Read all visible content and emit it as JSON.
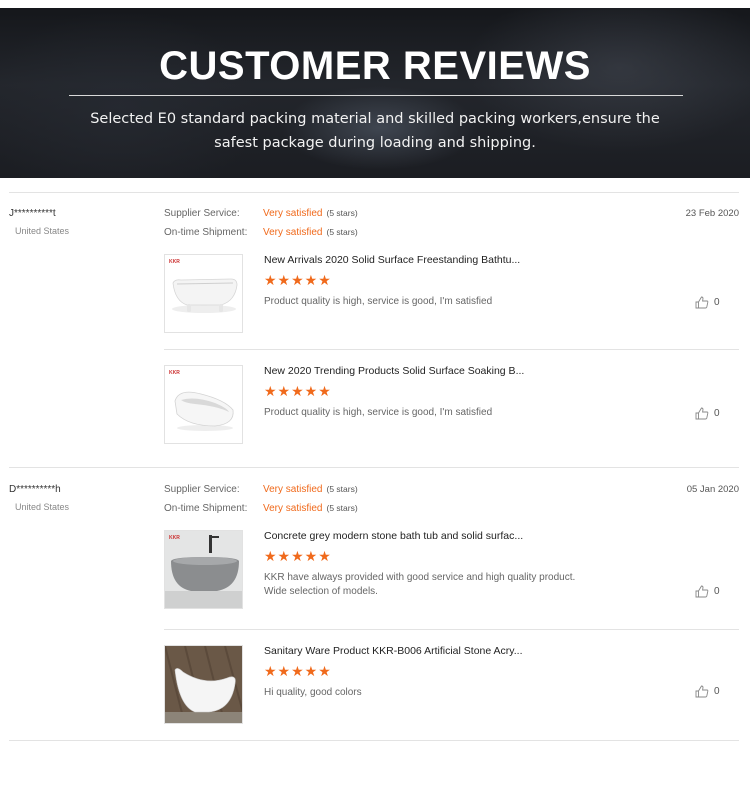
{
  "hero": {
    "title": "CUSTOMER REVIEWS",
    "subtitle": "Selected E0 standard packing material and skilled packing workers,ensure the safest package during loading and shipping."
  },
  "reviews": [
    {
      "name": "J**********t",
      "country": "United States",
      "date": "23 Feb 2020",
      "ratings": [
        {
          "label": "Supplier Service:",
          "value": "Very satisfied",
          "note": "(5 stars)"
        },
        {
          "label": "On-time Shipment:",
          "value": "Very satisfied",
          "note": "(5 stars)"
        }
      ],
      "products": [
        {
          "title": "New Arrivals 2020 Solid Surface Freestanding Bathtu...",
          "stars": "★★★★★",
          "comment": "Product quality is high, service is good, I'm satisfied",
          "likes": "0",
          "brand": "KKR"
        },
        {
          "title": "New 2020 Trending Products Solid Surface Soaking B...",
          "stars": "★★★★★",
          "comment": "Product quality is high, service is good, I'm satisfied",
          "likes": "0",
          "brand": "KKR"
        }
      ]
    },
    {
      "name": "D**********h",
      "country": "United States",
      "date": "05 Jan 2020",
      "ratings": [
        {
          "label": "Supplier Service:",
          "value": "Very satisfied",
          "note": "(5 stars)"
        },
        {
          "label": "On-time Shipment:",
          "value": "Very satisfied",
          "note": "(5 stars)"
        }
      ],
      "products": [
        {
          "title": "Concrete grey modern stone bath tub and solid surfac...",
          "stars": "★★★★★",
          "comment": "KKR have always provided with good service and high quality product.\nWide selection of models.",
          "likes": "0",
          "brand": "KKR"
        },
        {
          "title": "Sanitary Ware Product KKR-B006 Artificial Stone Acry...",
          "stars": "★★★★★",
          "comment": "Hi quality, good colors",
          "likes": "0"
        }
      ]
    }
  ],
  "colors": {
    "accent": "#f06a1c",
    "hero_bg": "#1b1d22"
  },
  "icons": {
    "like": "thumbs-up-icon",
    "rating": "star-icon"
  }
}
